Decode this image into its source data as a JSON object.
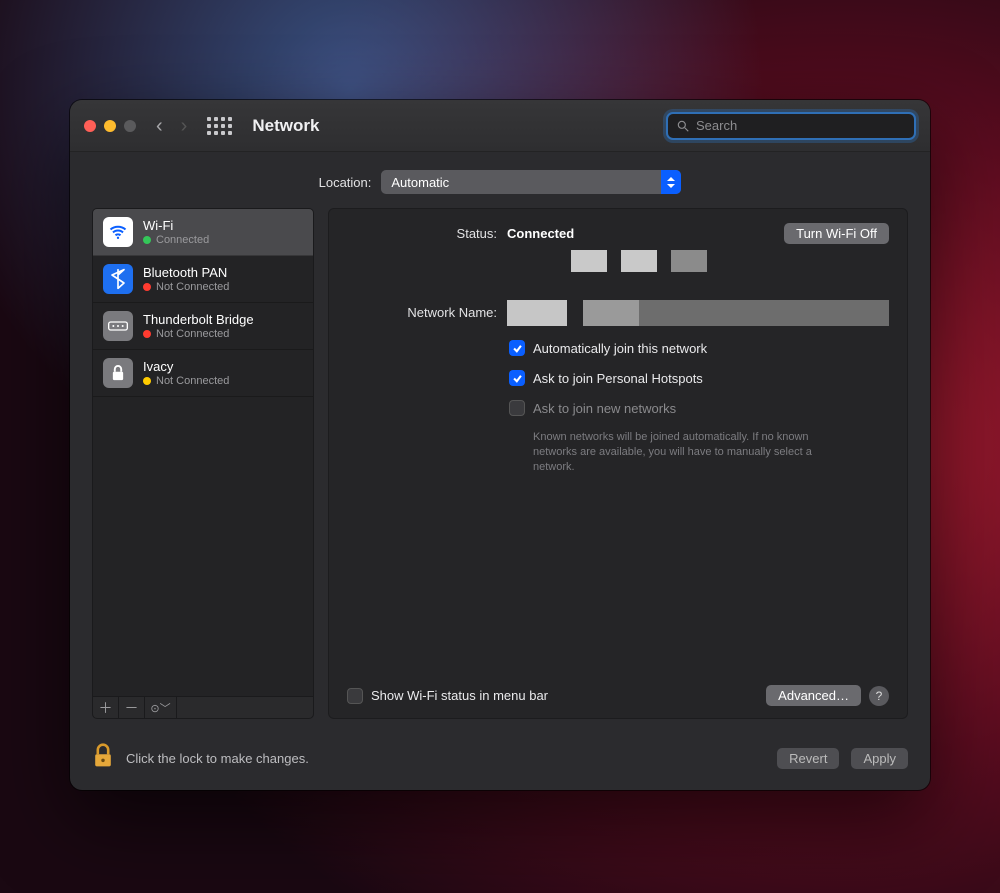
{
  "titlebar": {
    "title": "Network",
    "search_placeholder": "Search"
  },
  "location": {
    "label": "Location:",
    "value": "Automatic"
  },
  "sidebar": {
    "items": [
      {
        "name": "Wi-Fi",
        "status": "Connected",
        "dot": "green",
        "icon": "wifi",
        "selected": true
      },
      {
        "name": "Bluetooth PAN",
        "status": "Not Connected",
        "dot": "red",
        "icon": "bluetooth"
      },
      {
        "name": "Thunderbolt Bridge",
        "status": "Not Connected",
        "dot": "red",
        "icon": "thunderbolt"
      },
      {
        "name": "Ivacy",
        "status": "Not Connected",
        "dot": "yellow",
        "icon": "lock"
      }
    ]
  },
  "detail": {
    "status_label": "Status:",
    "status_value": "Connected",
    "toggle_button": "Turn Wi-Fi Off",
    "network_name_label": "Network Name:",
    "auto_join": "Automatically join this network",
    "ask_hotspot": "Ask to join Personal Hotspots",
    "ask_new": "Ask to join new networks",
    "ask_new_help": "Known networks will be joined automatically. If no known networks are available, you will have to manually select a network.",
    "show_status": "Show Wi-Fi status in menu bar",
    "advanced": "Advanced…"
  },
  "footer": {
    "lock_text": "Click the lock to make changes.",
    "revert": "Revert",
    "apply": "Apply"
  }
}
